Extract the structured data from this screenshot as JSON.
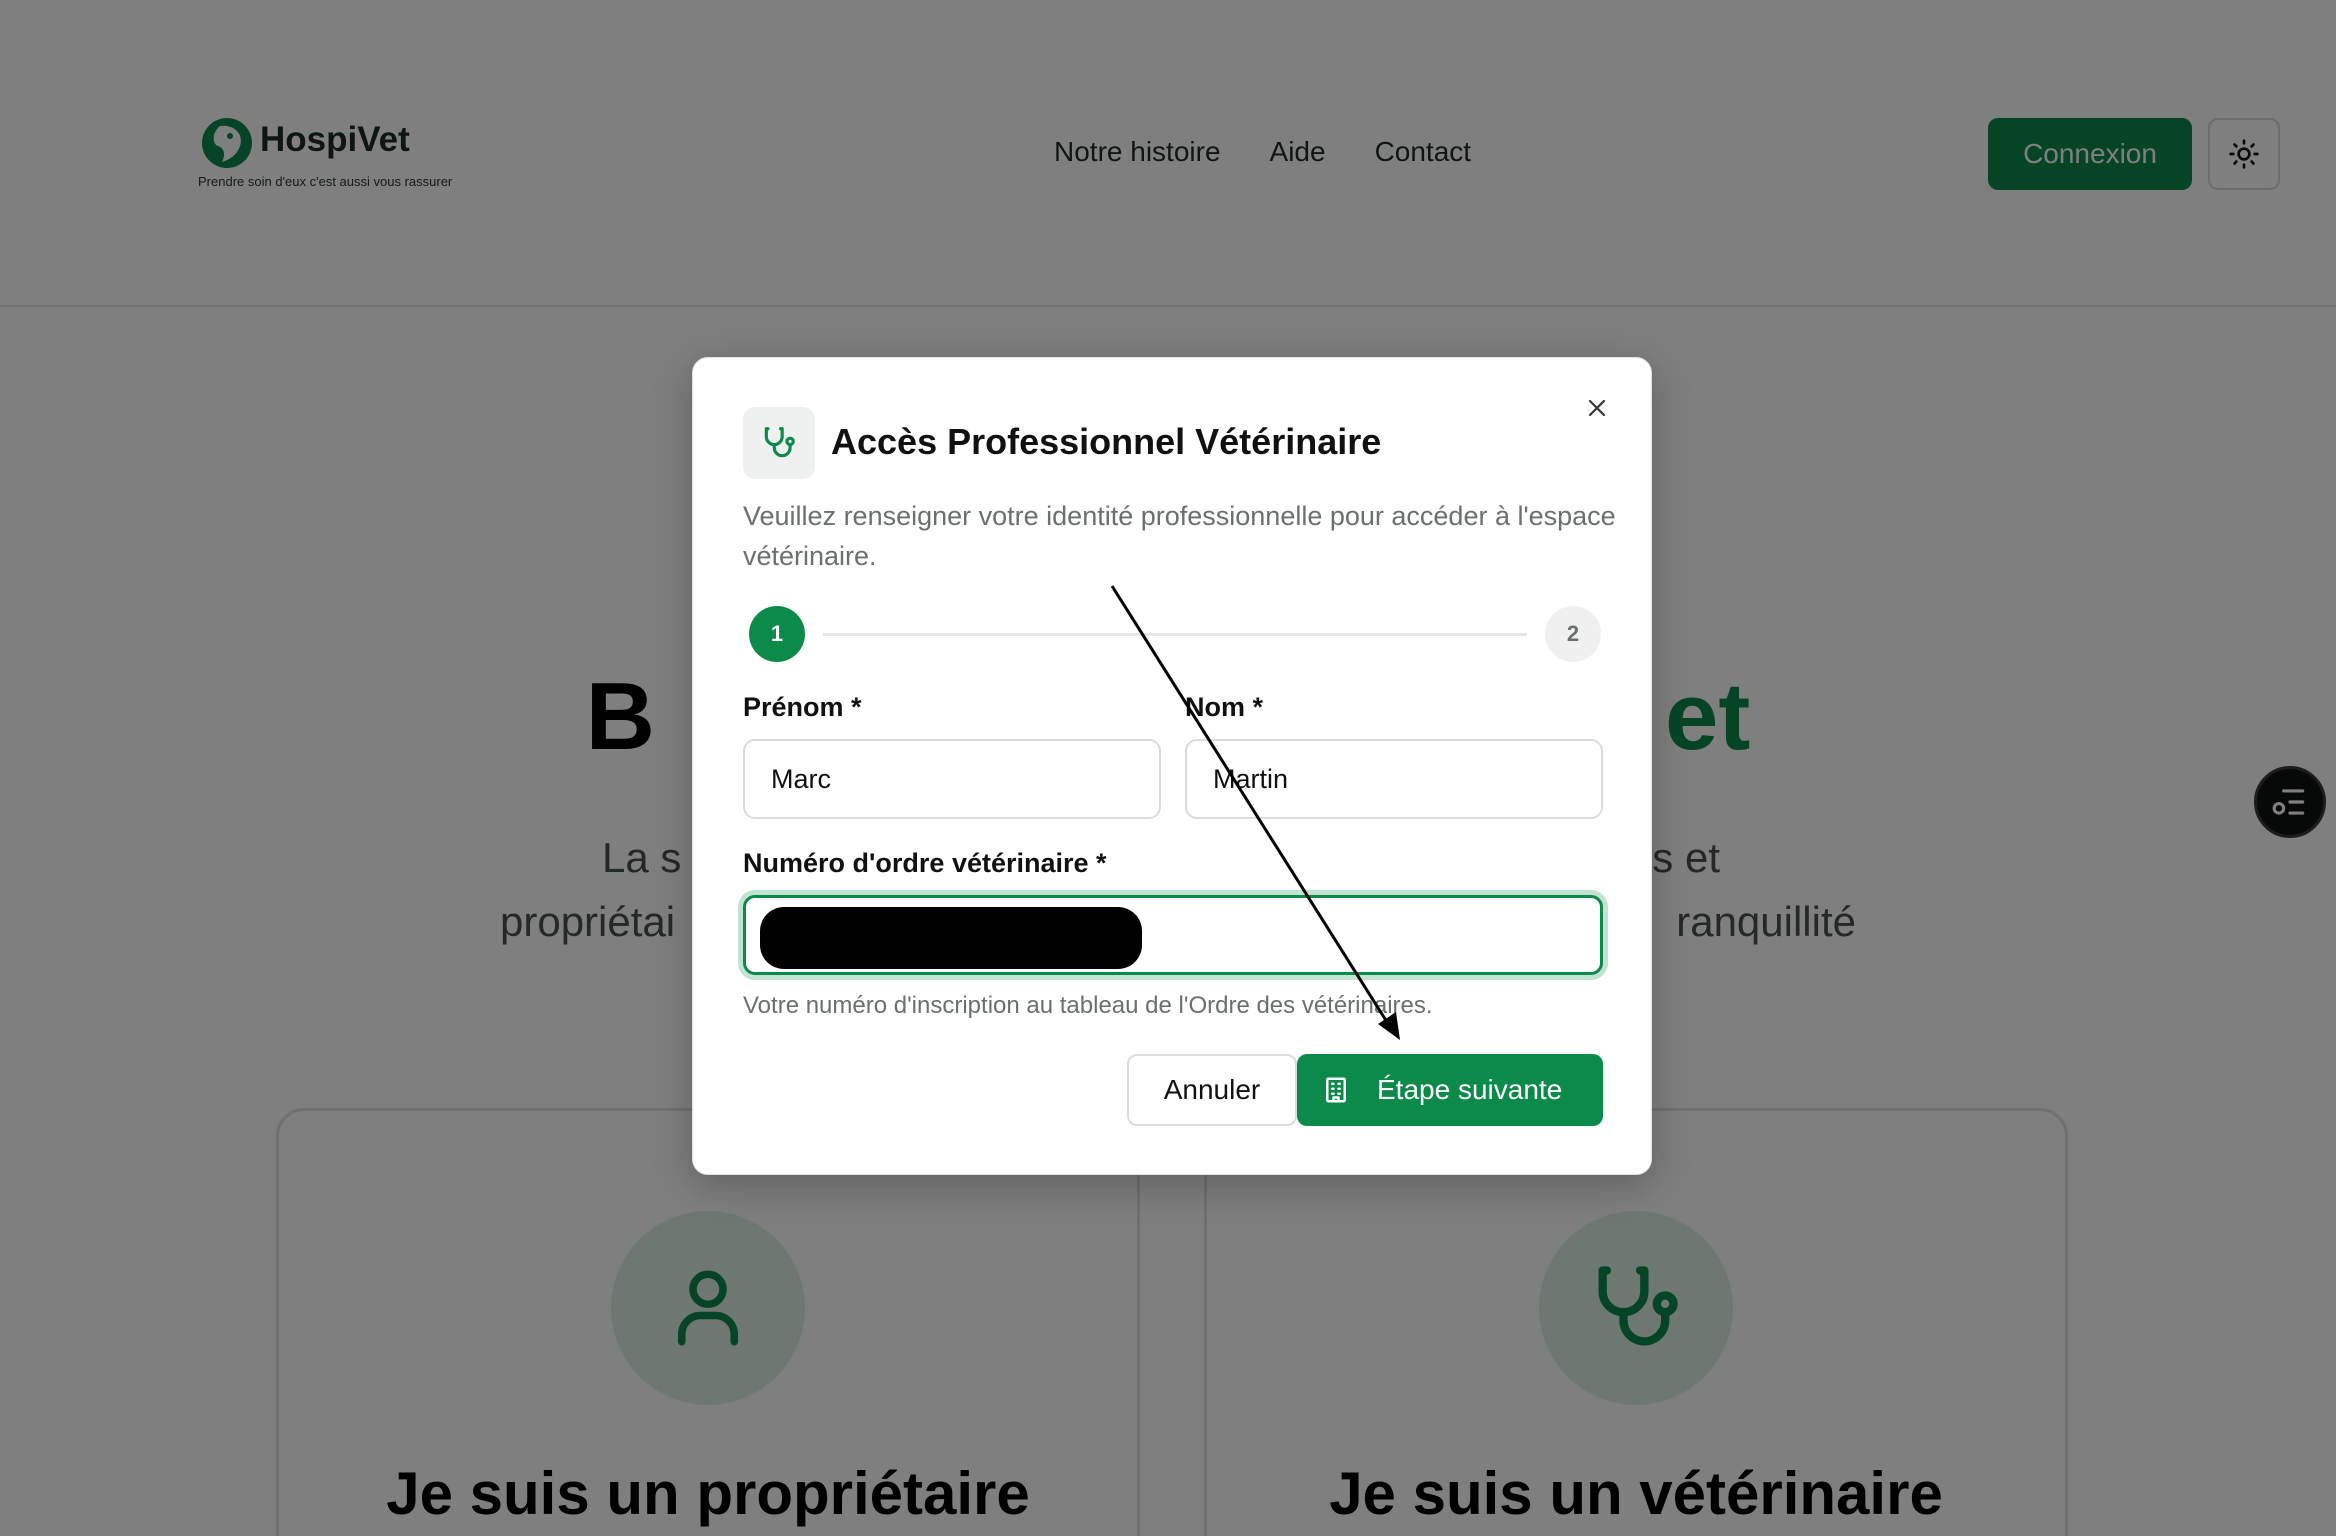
{
  "header": {
    "brand_name": "HospiVet",
    "brand_tagline": "Prendre soin d'eux c'est aussi vous rassurer",
    "nav": [
      {
        "label": "Notre histoire"
      },
      {
        "label": "Aide"
      },
      {
        "label": "Contact"
      }
    ],
    "login_label": "Connexion",
    "theme_toggle_icon": "sun-icon"
  },
  "hero": {
    "title_start": "B",
    "title_end": "et",
    "subtitle_line1_start": "La s",
    "subtitle_line1_end": "es et",
    "subtitle_line2_start": "propriétai",
    "subtitle_line2_end": "ranquillité"
  },
  "cards": {
    "owner_title": "Je suis un propriétaire",
    "owner_icon": "user-icon",
    "vet_title": "Je suis un vétérinaire",
    "vet_icon": "stethoscope-icon"
  },
  "modal": {
    "icon": "stethoscope-icon",
    "title": "Accès Professionnel Vétérinaire",
    "description": "Veuillez renseigner votre identité professionnelle pour accéder à l'espace vétérinaire.",
    "steps": [
      "1",
      "2"
    ],
    "current_step": 1,
    "fields": {
      "first_name_label": "Prénom *",
      "first_name_value": "Marc",
      "last_name_label": "Nom *",
      "last_name_value": "Martin",
      "order_number_label": "Numéro d'ordre vétérinaire *",
      "order_number_value": "",
      "order_number_helper": "Votre numéro d'inscription au tableau de l'Ordre des vétérinaires."
    },
    "cancel_label": "Annuler",
    "next_label": "Étape suivante",
    "next_icon": "building-icon"
  },
  "colors": {
    "accent": "#0b8a4a",
    "overlay": "rgba(0,0,0,0.5)"
  }
}
